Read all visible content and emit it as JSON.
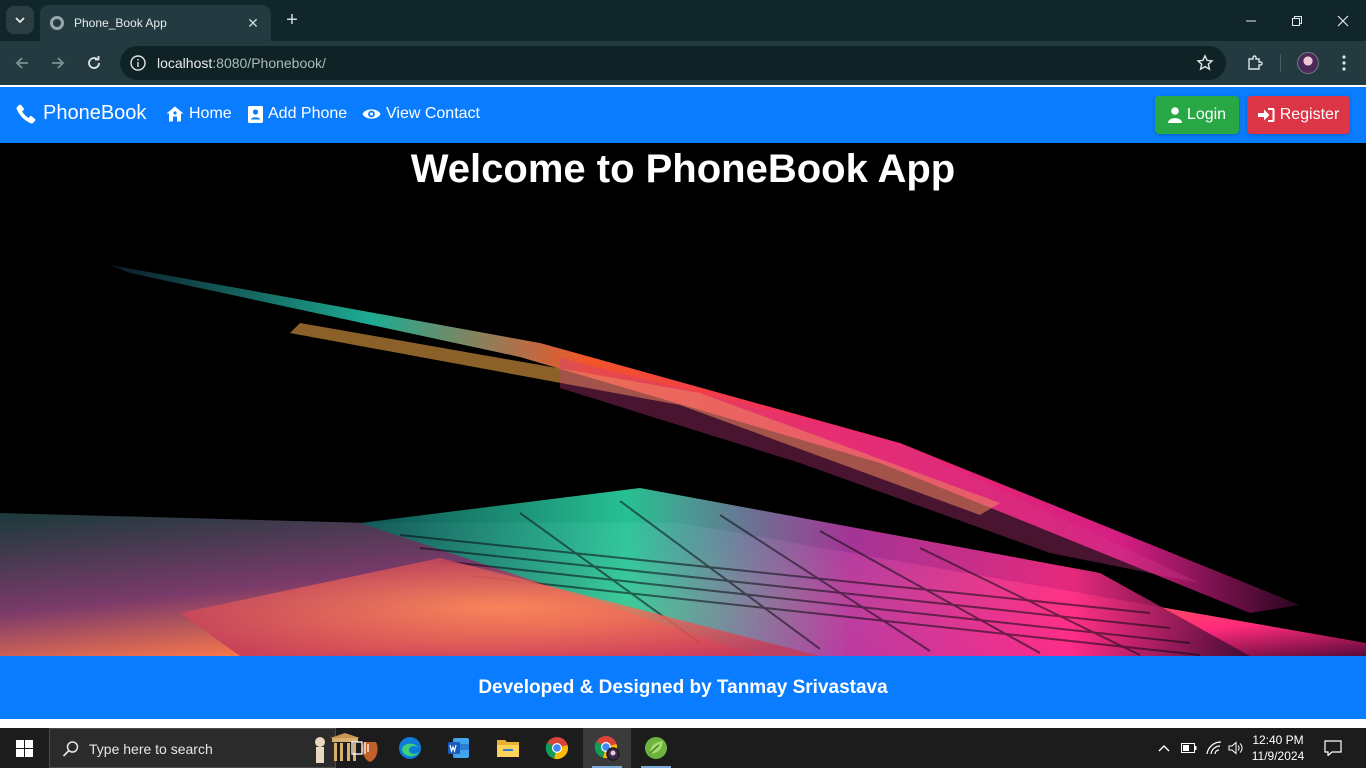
{
  "browser": {
    "tab_title": "Phone_Book App",
    "tab_close": "✕",
    "new_tab": "+",
    "url_host": "localhost",
    "url_rest": ":8080/Phonebook/"
  },
  "navbar": {
    "brand": "PhoneBook",
    "links": [
      {
        "label": "Home",
        "icon": "home-icon"
      },
      {
        "label": "Add Phone",
        "icon": "contact-card-icon"
      },
      {
        "label": "View Contact",
        "icon": "eye-icon"
      }
    ],
    "login_label": "Login",
    "register_label": "Register",
    "colors": {
      "primary": "#0a7cff",
      "login": "#28a745",
      "register": "#dc3545"
    }
  },
  "hero": {
    "title": "Welcome to PhoneBook App"
  },
  "footer": {
    "text": "Developed & Designed by Tanmay Srivastava"
  },
  "taskbar": {
    "search_placeholder": "Type here to search",
    "apps": [
      "task-view",
      "edge",
      "word",
      "file-explorer",
      "chrome",
      "chrome-profile",
      "spring-tool-suite"
    ],
    "time": "12:40 PM",
    "date": "11/9/2024"
  }
}
